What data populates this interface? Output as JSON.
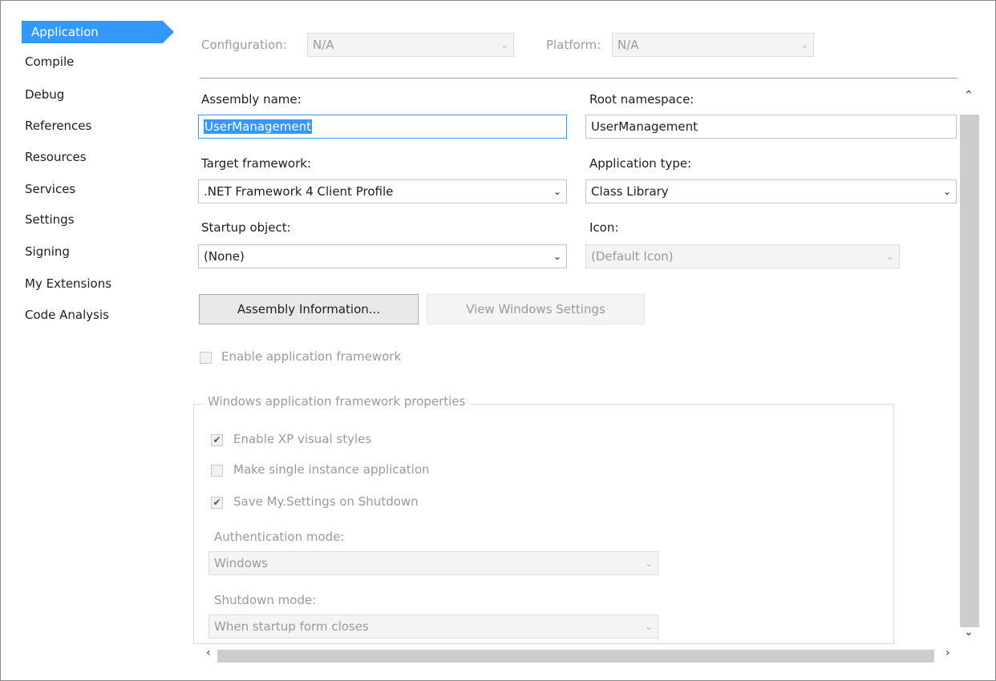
{
  "sidebar": {
    "items": [
      {
        "label": "Application",
        "active": true
      },
      {
        "label": "Compile"
      },
      {
        "label": "Debug"
      },
      {
        "label": "References"
      },
      {
        "label": "Resources"
      },
      {
        "label": "Services"
      },
      {
        "label": "Settings"
      },
      {
        "label": "Signing"
      },
      {
        "label": "My Extensions"
      },
      {
        "label": "Code Analysis"
      }
    ]
  },
  "config_bar": {
    "configuration_label": "Configuration:",
    "configuration_value": "N/A",
    "platform_label": "Platform:",
    "platform_value": "N/A"
  },
  "form": {
    "assembly_name_label": "Assembly name:",
    "assembly_name_value": "UserManagement",
    "root_namespace_label": "Root namespace:",
    "root_namespace_value": "UserManagement",
    "target_framework_label": "Target framework:",
    "target_framework_value": ".NET Framework 4 Client Profile",
    "application_type_label": "Application type:",
    "application_type_value": "Class Library",
    "startup_object_label": "Startup object:",
    "startup_object_value": "(None)",
    "icon_label": "Icon:",
    "icon_value": "(Default Icon)"
  },
  "buttons": {
    "assembly_information": "Assembly Information...",
    "view_windows_settings": "View Windows Settings"
  },
  "enable_app_framework": {
    "label": "Enable application framework",
    "checked": false
  },
  "framework_group": {
    "title": "Windows application framework properties",
    "enable_xp_styles": {
      "label": "Enable XP visual styles",
      "checked": true
    },
    "single_instance": {
      "label": "Make single instance application",
      "checked": false
    },
    "save_settings": {
      "label": "Save My.Settings on Shutdown",
      "checked": true
    },
    "authentication_mode_label": "Authentication mode:",
    "authentication_mode_value": "Windows",
    "shutdown_mode_label": "Shutdown mode:",
    "shutdown_mode_value": "When startup form closes"
  },
  "icons": {
    "dropdown": "chevron-down-icon",
    "check": "checkmark-icon",
    "scroll_up": "scroll-up-arrow-icon",
    "scroll_down": "scroll-down-arrow-icon",
    "scroll_left": "scroll-left-arrow-icon",
    "scroll_right": "scroll-right-arrow-icon"
  },
  "colors": {
    "accent": "#3399ff",
    "disabled_text": "#9a9a9a"
  }
}
